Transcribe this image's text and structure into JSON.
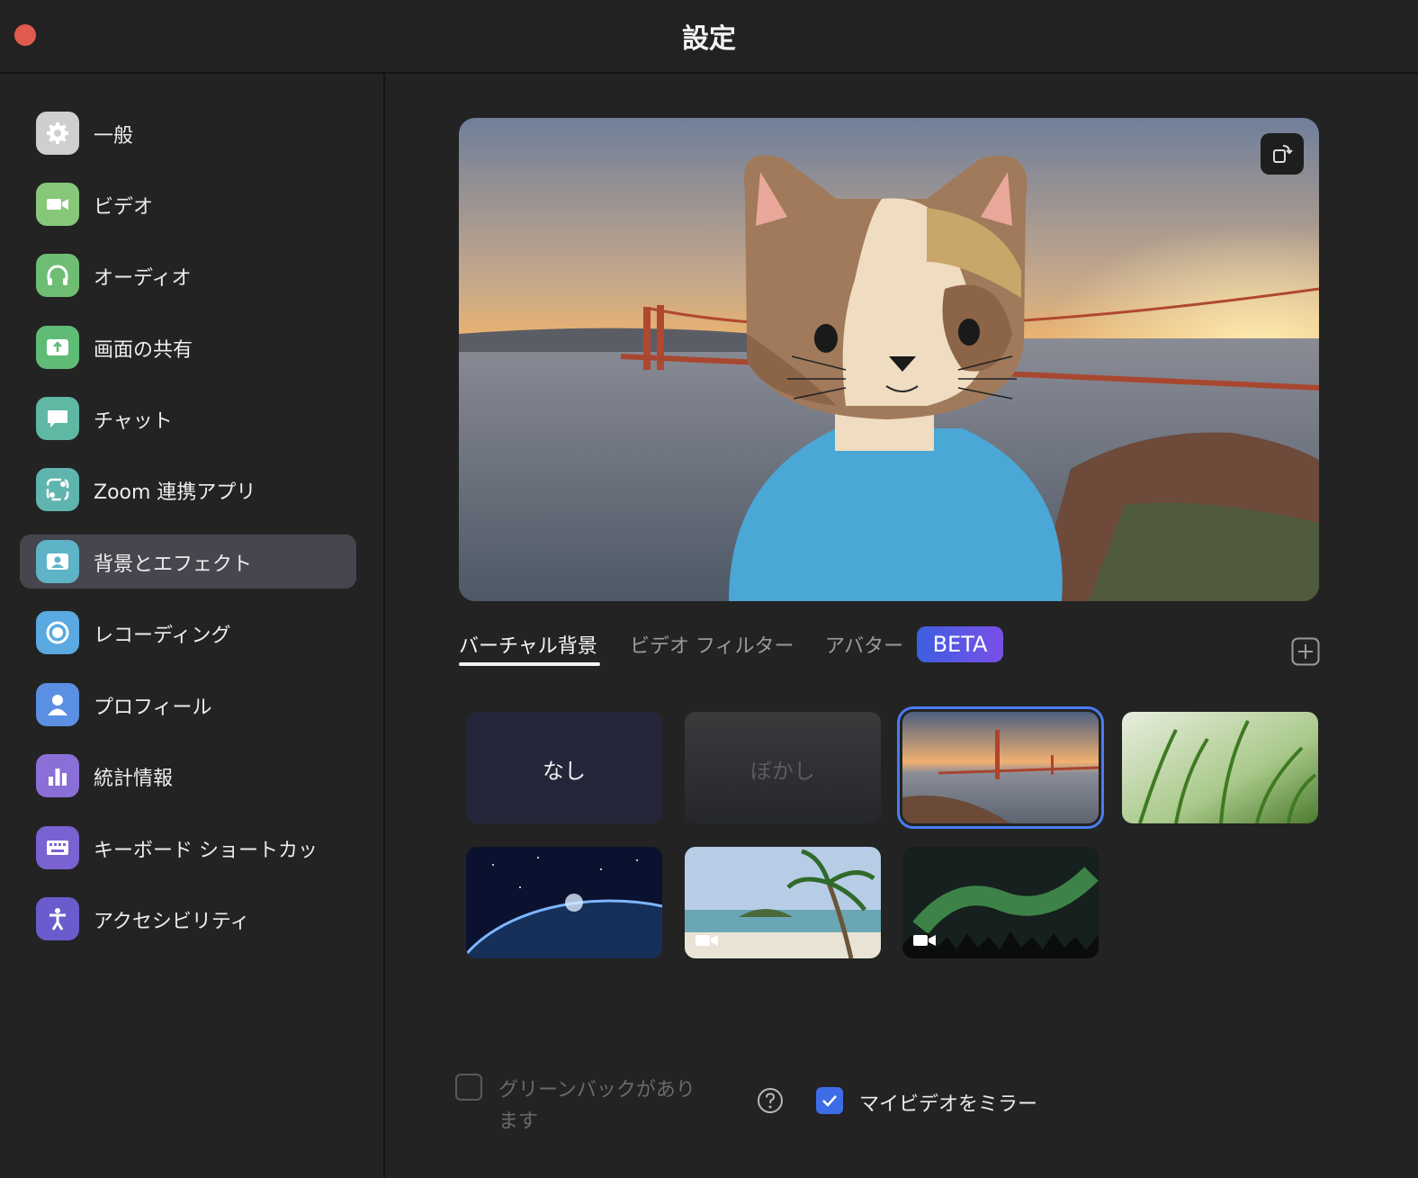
{
  "window": {
    "title": "設定"
  },
  "sidebar": {
    "items": [
      {
        "label": "一般",
        "icon": "gear-icon",
        "color": "#d0d0d0"
      },
      {
        "label": "ビデオ",
        "icon": "video-camera-icon",
        "color": "#86c77a"
      },
      {
        "label": "オーディオ",
        "icon": "headphones-icon",
        "color": "#6fbd73"
      },
      {
        "label": "画面の共有",
        "icon": "share-screen-icon",
        "color": "#5fbc77"
      },
      {
        "label": "チャット",
        "icon": "chat-bubble-icon",
        "color": "#5fb8a4"
      },
      {
        "label": "Zoom 連携アプリ",
        "icon": "apps-icon",
        "color": "#5fb5ad"
      },
      {
        "label": "背景とエフェクト",
        "icon": "background-portrait-icon",
        "color": "#5fb3c6"
      },
      {
        "label": "レコーディング",
        "icon": "record-icon",
        "color": "#5aa9e0"
      },
      {
        "label": "プロフィール",
        "icon": "person-icon",
        "color": "#5b8fe2"
      },
      {
        "label": "統計情報",
        "icon": "bar-chart-icon",
        "color": "#8a6fd6"
      },
      {
        "label": "キーボード ショートカッ",
        "icon": "keyboard-icon",
        "color": "#7a62d2"
      },
      {
        "label": "アクセシビリティ",
        "icon": "accessibility-icon",
        "color": "#6b5ccd"
      }
    ],
    "active_index": 6
  },
  "tabs": [
    {
      "label": "バーチャル背景",
      "active": true
    },
    {
      "label": "ビデオ フィルター",
      "active": false
    },
    {
      "label": "アバター",
      "active": false
    }
  ],
  "beta_badge": "BETA",
  "backgrounds": {
    "none_label": "なし",
    "blur_label": "ぼかし",
    "items": [
      {
        "name": "golden-gate-bridge",
        "selected": true
      },
      {
        "name": "grass",
        "selected": false
      },
      {
        "name": "earth-from-space",
        "selected": false
      },
      {
        "name": "beach-palm",
        "selected": false,
        "video": true
      },
      {
        "name": "aurora",
        "selected": false,
        "video": true
      }
    ]
  },
  "options": {
    "green_screen_label_line1": "グリーンバックがあり",
    "green_screen_label_line2": "ます",
    "green_screen_checked": false,
    "mirror_label": "マイビデオをミラー",
    "mirror_checked": true
  },
  "accent_color": "#3d6de6"
}
